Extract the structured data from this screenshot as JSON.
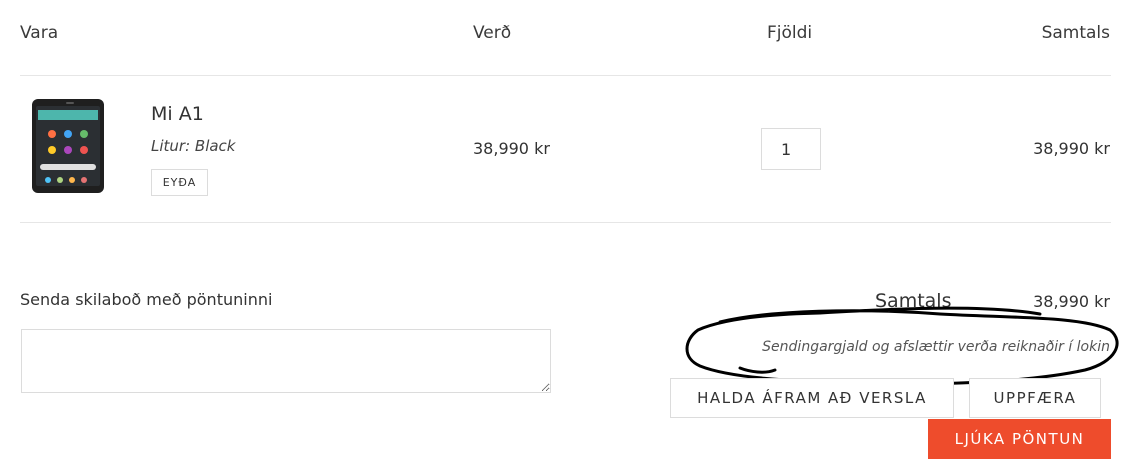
{
  "table": {
    "headers": {
      "product": "Vara",
      "price": "Verð",
      "quantity": "Fjöldi",
      "total": "Samtals"
    }
  },
  "cart": {
    "items": [
      {
        "name": "Mi A1",
        "variant": "Litur: Black",
        "remove_label": "EYÐA",
        "price": "38,990 kr",
        "quantity": "1",
        "total": "38,990 kr",
        "thumbnail_icon": "smartphone-icon"
      }
    ]
  },
  "note": {
    "label": "Senda skilaboð með pöntuninni",
    "value": ""
  },
  "summary": {
    "subtotal_label": "Samtals",
    "subtotal_value": "38,990 kr",
    "shipping_note": "Sendingargjald og afslættir verða reiknaðir í lokin"
  },
  "buttons": {
    "continue_shopping": "HALDA ÁFRAM AÐ VERSLA",
    "update": "UPPFÆRA",
    "checkout": "LJÚKA PÖNTUN"
  },
  "colors": {
    "accent": "#ee4c2c",
    "border": "#dcdcdc",
    "divider": "#e6e6e6"
  }
}
